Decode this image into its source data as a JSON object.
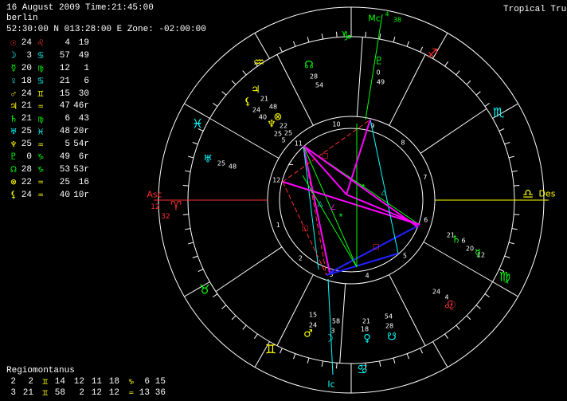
{
  "header": {
    "date_time": "16 August 2009 Time:21:45:00",
    "place": "berlin",
    "coords": "52:30:00 N 013:28:00 E Zone: -02:00:00",
    "mode": "Tropical True"
  },
  "positions": [
    {
      "glyph": "☉",
      "color": "#ff3030",
      "deg": "24",
      "sign": "♌",
      "sign_color": "#ff3030",
      "min": "4",
      "sec": "19"
    },
    {
      "glyph": "☽",
      "color": "#00ffff",
      "deg": "3",
      "sign": "♋",
      "sign_color": "#00ffff",
      "min": "57",
      "sec": "49"
    },
    {
      "glyph": "☿",
      "color": "#00ff00",
      "deg": "20",
      "sign": "♍",
      "sign_color": "#00ff00",
      "min": "12",
      "sec": "1"
    },
    {
      "glyph": "♀",
      "color": "#00ffff",
      "deg": "18",
      "sign": "♋",
      "sign_color": "#00ffff",
      "min": "21",
      "sec": "6"
    },
    {
      "glyph": "♂",
      "color": "#ffff00",
      "deg": "24",
      "sign": "♊",
      "sign_color": "#ffff00",
      "min": "15",
      "sec": "30"
    },
    {
      "glyph": "♃",
      "color": "#ffff00",
      "deg": "21",
      "sign": "♒",
      "sign_color": "#ffff00",
      "min": "47",
      "sec": "46r"
    },
    {
      "glyph": "♄",
      "color": "#00ff00",
      "deg": "21",
      "sign": "♍",
      "sign_color": "#00ff00",
      "min": "6",
      "sec": "43"
    },
    {
      "glyph": "♅",
      "color": "#00ffff",
      "deg": "25",
      "sign": "♓",
      "sign_color": "#00ffff",
      "min": "48",
      "sec": "20r"
    },
    {
      "glyph": "♆",
      "color": "#ffff00",
      "deg": "25",
      "sign": "♒",
      "sign_color": "#ffff00",
      "min": "5",
      "sec": "54r"
    },
    {
      "glyph": "♇",
      "color": "#00ff00",
      "deg": "0",
      "sign": "♑",
      "sign_color": "#00ff00",
      "min": "49",
      "sec": "6r"
    },
    {
      "glyph": "☊",
      "color": "#00ff00",
      "deg": "28",
      "sign": "♑",
      "sign_color": "#00ff00",
      "min": "53",
      "sec": "53r"
    },
    {
      "glyph": "⊗",
      "color": "#ffff00",
      "deg": "22",
      "sign": "♒",
      "sign_color": "#ffff00",
      "min": "25",
      "sec": "16"
    },
    {
      "glyph": "⚸",
      "color": "#ffff00",
      "deg": "24",
      "sign": "♒",
      "sign_color": "#ffff00",
      "min": "40",
      "sec": "10r"
    }
  ],
  "regiomontanus": {
    "title": "Regiomontanus",
    "rows": [
      [
        {
          "t": "2"
        },
        {
          "t": "2"
        },
        {
          "t": "♊",
          "g": true
        },
        {
          "t": "14"
        },
        {
          "t": "12"
        },
        {
          "t": "11"
        },
        {
          "t": "18"
        },
        {
          "t": "♑",
          "g": true
        },
        {
          "t": "6"
        },
        {
          "t": "15"
        }
      ],
      [
        {
          "t": "3"
        },
        {
          "t": "21"
        },
        {
          "t": "♊",
          "g": true
        },
        {
          "t": "58"
        },
        {
          "t": "2"
        },
        {
          "t": "12"
        },
        {
          "t": "12"
        },
        {
          "t": "♒",
          "g": true
        },
        {
          "t": "13"
        },
        {
          "t": "36"
        }
      ]
    ]
  },
  "chart": {
    "angles": {
      "asc": "Asc",
      "asc_deg": "12",
      "asc_min": "32",
      "des": "Des",
      "mc": "Mc",
      "mc_deg": "4",
      "mc_min": "38",
      "ic": "Ic"
    },
    "house_numbers": [
      "1",
      "2",
      "3",
      "4",
      "5",
      "6",
      "7",
      "8",
      "9",
      "10",
      "11",
      "12"
    ],
    "zodiac_signs": [
      {
        "glyph": "♈",
        "color": "#ff3030"
      },
      {
        "glyph": "♉",
        "color": "#00ff00"
      },
      {
        "glyph": "♊",
        "color": "#ffff00"
      },
      {
        "glyph": "♋",
        "color": "#00ffff"
      },
      {
        "glyph": "♌",
        "color": "#ff3030"
      },
      {
        "glyph": "♍",
        "color": "#00ff00"
      },
      {
        "glyph": "♎",
        "color": "#ffff00"
      },
      {
        "glyph": "♏",
        "color": "#00ffff"
      },
      {
        "glyph": "♐",
        "color": "#ff3030"
      },
      {
        "glyph": "♑",
        "color": "#00ff00"
      },
      {
        "glyph": "♒",
        "color": "#ffff00"
      },
      {
        "glyph": "♓",
        "color": "#00ffff"
      }
    ],
    "planet_labels": [
      {
        "glyph": "☊",
        "color": "#00ff00",
        "deg": "28",
        "min": "54"
      },
      {
        "glyph": "♇",
        "color": "#00ff00",
        "deg": "0",
        "min": "49"
      },
      {
        "glyph": "♃",
        "color": "#ffff00",
        "deg": "21",
        "min": "48"
      },
      {
        "glyph": "⚸",
        "color": "#ffff00",
        "deg": "24",
        "min": "40"
      },
      {
        "glyph": "⊗",
        "color": "#ffff00",
        "deg": "22",
        "min": "25"
      },
      {
        "glyph": "♆",
        "color": "#ffff00",
        "deg": "25",
        "min": "5"
      },
      {
        "glyph": "♅",
        "color": "#00ffff",
        "deg": "25",
        "min": "48"
      },
      {
        "glyph": "♄",
        "color": "#00ff00",
        "deg": "21",
        "min": "6"
      },
      {
        "glyph": "☿",
        "color": "#00ff00",
        "deg": "20",
        "min": "12"
      },
      {
        "glyph": "☉",
        "color": "#ff3030",
        "deg": "24",
        "min": "4"
      },
      {
        "glyph": "♂",
        "color": "#ffff00",
        "deg": "24",
        "min": "15"
      },
      {
        "glyph": "☽",
        "color": "#00ffff",
        "deg": "3",
        "min": "58"
      },
      {
        "glyph": "♀",
        "color": "#00ffff",
        "deg": "18",
        "min": "21"
      },
      {
        "glyph": "☋",
        "color": "#00ffff",
        "deg": "28",
        "min": "54"
      }
    ]
  },
  "colors": {
    "background": "#000000",
    "red": "#ff3030",
    "green": "#00ff00",
    "cyan": "#00ffff",
    "yellow": "#ffff00",
    "magenta": "#ff00ff",
    "blue": "#2020ff",
    "white": "#ffffff"
  }
}
